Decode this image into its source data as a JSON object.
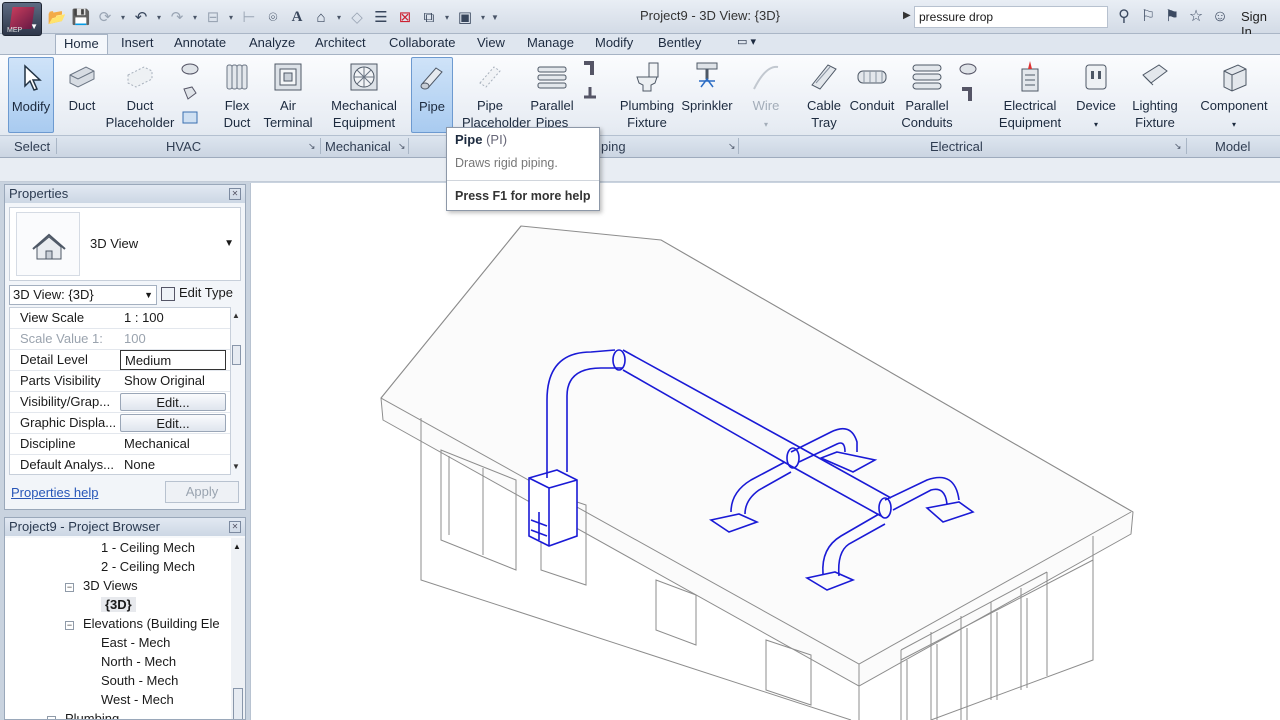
{
  "app": {
    "title": "Project9 - 3D View: {3D}",
    "search_value": "pressure drop",
    "signin_label": "Sign In",
    "logo_sub": "MEP"
  },
  "tabs": [
    "Home",
    "Insert",
    "Annotate",
    "Analyze",
    "Architect",
    "Collaborate",
    "View",
    "Manage",
    "Modify",
    "Bentley"
  ],
  "active_tab": "Home",
  "ribbon": {
    "modify": "Modify",
    "duct": "Duct",
    "duct_placeholder_1": "Duct",
    "duct_placeholder_2": "Placeholder",
    "flex_duct_1": "Flex",
    "flex_duct_2": "Duct",
    "air_terminal_1": "Air",
    "air_terminal_2": "Terminal",
    "mech_equip_1": "Mechanical",
    "mech_equip_2": "Equipment",
    "pipe": "Pipe",
    "pipe_placeholder_1": "Pipe",
    "pipe_placeholder_2": "Placeholder",
    "parallel_pipes_1": "Parallel",
    "parallel_pipes_2": "Pipes",
    "plumbing_fixture_1": "Plumbing",
    "plumbing_fixture_2": "Fixture",
    "sprinkler": "Sprinkler",
    "wire": "Wire",
    "cable_tray_1": "Cable",
    "cable_tray_2": "Tray",
    "conduit": "Conduit",
    "parallel_conduits_1": "Parallel",
    "parallel_conduits_2": "Conduits",
    "elec_equip_1": "Electrical",
    "elec_equip_2": "Equipment",
    "device": "Device",
    "lighting_fixture_1": "Lighting",
    "lighting_fixture_2": "Fixture",
    "component": "Component",
    "panels": {
      "select": "Select",
      "hvac": "HVAC",
      "mechanical": "Mechanical",
      "plumbing_partial": "ping",
      "electrical": "Electrical",
      "model": "Model"
    }
  },
  "tooltip": {
    "title": "Pipe",
    "shortcut": "(PI)",
    "description": "Draws rigid piping.",
    "help": "Press F1 for more help"
  },
  "properties": {
    "header": "Properties",
    "type_name": "3D View",
    "view_selector": "3D View: {3D}",
    "edit_type": "Edit Type",
    "rows": [
      {
        "key": "View Scale",
        "value": "1 : 100"
      },
      {
        "key": "Scale Value    1:",
        "value": "100"
      },
      {
        "key": "Detail Level",
        "value": "Medium"
      },
      {
        "key": "Parts Visibility",
        "value": "Show Original"
      },
      {
        "key": "Visibility/Grap...",
        "value": "Edit..."
      },
      {
        "key": "Graphic Displa...",
        "value": "Edit..."
      },
      {
        "key": "Discipline",
        "value": "Mechanical"
      },
      {
        "key": "Default Analys...",
        "value": "None"
      }
    ],
    "help_link": "Properties help",
    "apply": "Apply"
  },
  "browser": {
    "header": "Project9 - Project Browser",
    "items": [
      "1 - Ceiling Mech",
      "2 - Ceiling Mech",
      "3D Views",
      "{3D}",
      "Elevations (Building Ele",
      "East - Mech",
      "North - Mech",
      "South - Mech",
      "West - Mech",
      "Plumbing"
    ]
  },
  "colors": {
    "duct_blue": "#1a1ad6",
    "ribbon_selected": "#a9cbf0",
    "link": "#2856b8"
  }
}
